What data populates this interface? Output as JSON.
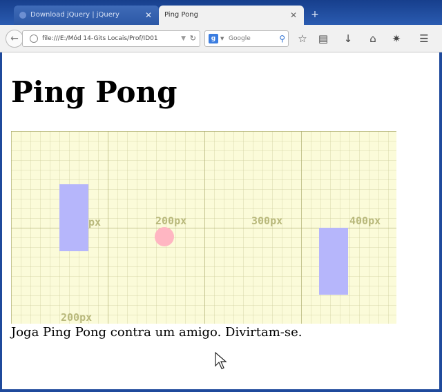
{
  "browser": {
    "tabs": [
      {
        "label": "Download jQuery | jQuery",
        "active": false
      },
      {
        "label": "Ping Pong",
        "active": true
      }
    ],
    "tab_close_glyph": "✕",
    "new_tab_glyph": "+",
    "url": "file:///E:/Mód 14-Gits Locais/Prof/ID01",
    "search_engine": "g",
    "search_placeholder": "Google",
    "icons": [
      "back-arrow-icon",
      "globe-icon",
      "reload-icon",
      "search-icon",
      "star-icon",
      "bookmarks-icon",
      "download-icon",
      "home-icon",
      "extension-icon",
      "menu-icon"
    ]
  },
  "page": {
    "title": "Ping Pong",
    "description": "Joga Ping Pong contra um amigo. Divirtam-se."
  },
  "game": {
    "board_color": "#fbfbd9",
    "paddle_color": "#b6b6fb",
    "ball_color": "#ffb6c2",
    "grid_labels": [
      "px",
      "200px",
      "300px",
      "400px",
      "200px"
    ]
  }
}
